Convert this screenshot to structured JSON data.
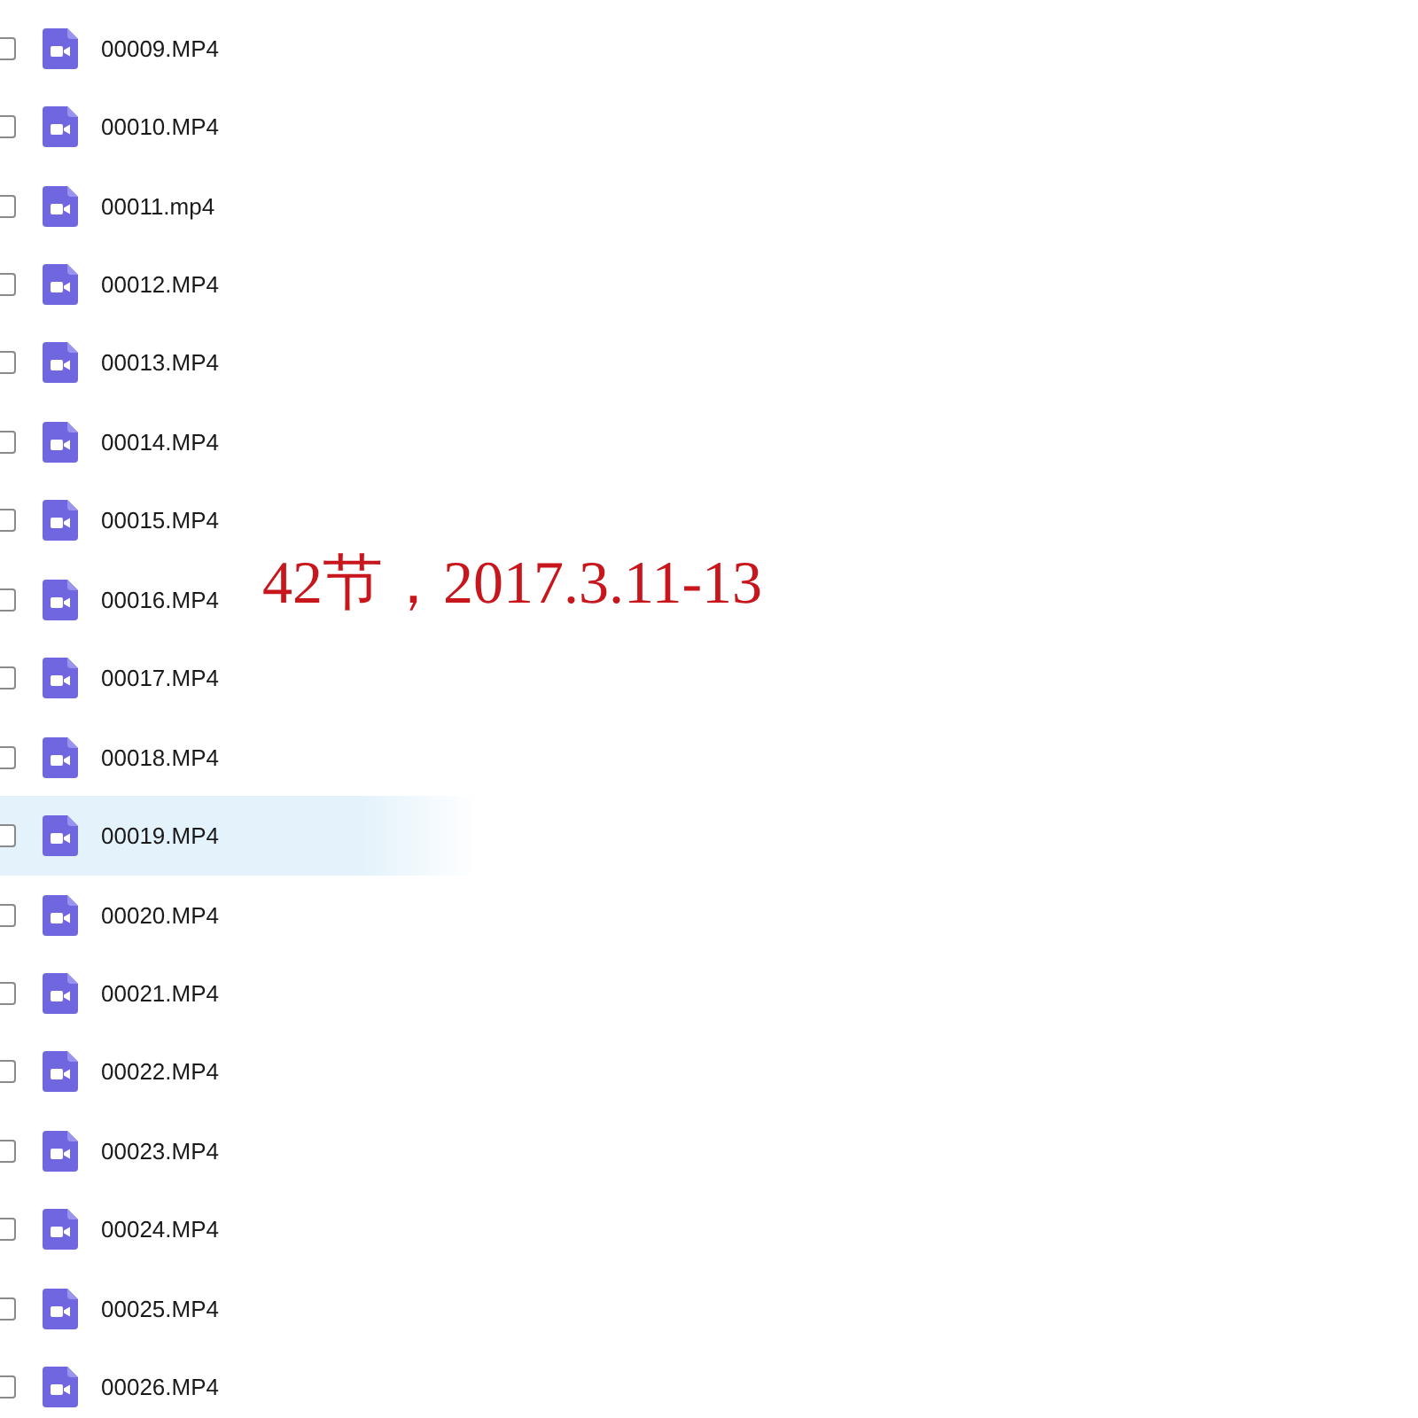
{
  "files": [
    {
      "name": "00009.MP4",
      "checked": false,
      "highlighted": false
    },
    {
      "name": "00010.MP4",
      "checked": false,
      "highlighted": false
    },
    {
      "name": "00011.mp4",
      "checked": false,
      "highlighted": false
    },
    {
      "name": "00012.MP4",
      "checked": false,
      "highlighted": false
    },
    {
      "name": "00013.MP4",
      "checked": false,
      "highlighted": false
    },
    {
      "name": "00014.MP4",
      "checked": false,
      "highlighted": false
    },
    {
      "name": "00015.MP4",
      "checked": false,
      "highlighted": false
    },
    {
      "name": "00016.MP4",
      "checked": false,
      "highlighted": false
    },
    {
      "name": "00017.MP4",
      "checked": false,
      "highlighted": false
    },
    {
      "name": "00018.MP4",
      "checked": false,
      "highlighted": false
    },
    {
      "name": "00019.MP4",
      "checked": false,
      "highlighted": true
    },
    {
      "name": "00020.MP4",
      "checked": false,
      "highlighted": false
    },
    {
      "name": "00021.MP4",
      "checked": false,
      "highlighted": false
    },
    {
      "name": "00022.MP4",
      "checked": false,
      "highlighted": false
    },
    {
      "name": "00023.MP4",
      "checked": false,
      "highlighted": false
    },
    {
      "name": "00024.MP4",
      "checked": false,
      "highlighted": false
    },
    {
      "name": "00025.MP4",
      "checked": false,
      "highlighted": false
    },
    {
      "name": "00026.MP4",
      "checked": false,
      "highlighted": false
    }
  ],
  "annotation": "42节，2017.3.11-13"
}
